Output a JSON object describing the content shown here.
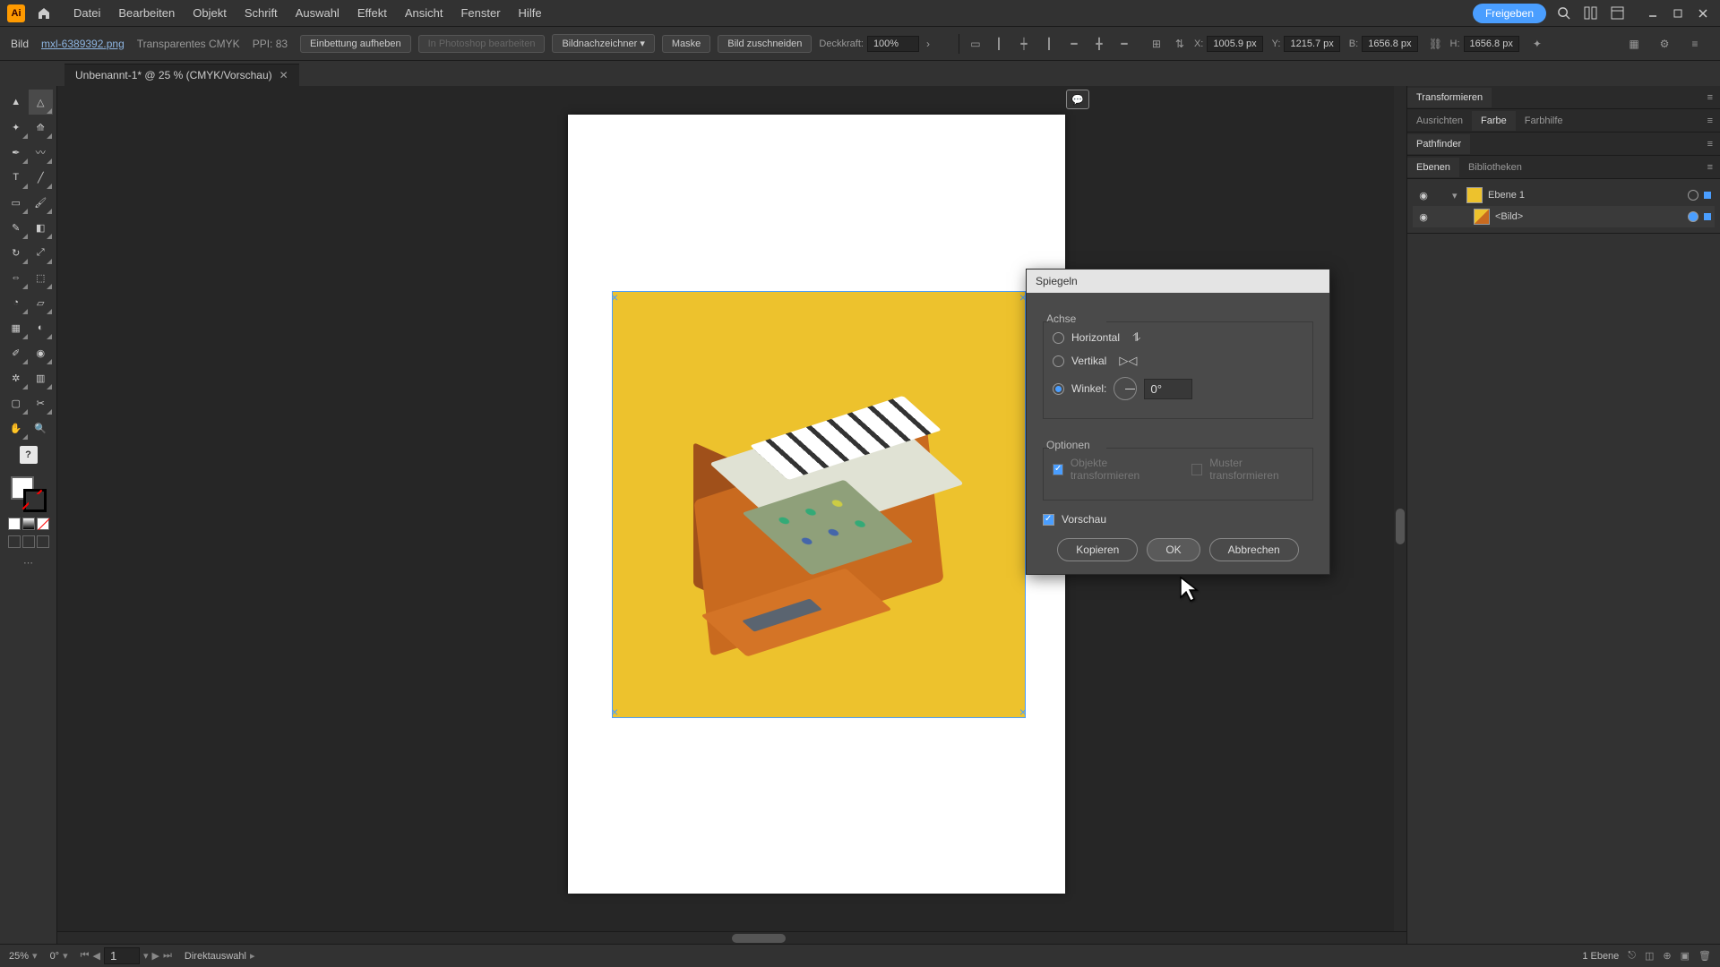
{
  "app": {
    "icon_text": "Ai",
    "share_label": "Freigeben"
  },
  "menu": [
    "Datei",
    "Bearbeiten",
    "Objekt",
    "Schrift",
    "Auswahl",
    "Effekt",
    "Ansicht",
    "Fenster",
    "Hilfe"
  ],
  "optionsbar": {
    "selection_type": "Bild",
    "filename": "mxl-6389392.png",
    "color_mode": "Transparentes CMYK",
    "ppi": "PPI: 83",
    "unembed": "Einbettung aufheben",
    "edit_ps": "In Photoshop bearbeiten",
    "tracer": "Bildnachzeichner",
    "mask": "Maske",
    "crop": "Bild zuschneiden",
    "opacity_label": "Deckkraft:",
    "opacity_value": "100%",
    "x_label": "X:",
    "x_value": "1005.9 px",
    "y_label": "Y:",
    "y_value": "1215.7 px",
    "w_label": "B:",
    "w_value": "1656.8 px",
    "h_label": "H:",
    "h_value": "1656.8 px"
  },
  "document": {
    "tab_title": "Unbenannt-1* @ 25 % (CMYK/Vorschau)"
  },
  "dialog": {
    "title": "Spiegeln",
    "axis_group": "Achse",
    "horizontal": "Horizontal",
    "vertical": "Vertikal",
    "angle_label": "Winkel:",
    "angle_value": "0°",
    "options_group": "Optionen",
    "transform_objects": "Objekte transformieren",
    "transform_patterns": "Muster transformieren",
    "preview": "Vorschau",
    "copy_btn": "Kopieren",
    "ok_btn": "OK",
    "cancel_btn": "Abbrechen"
  },
  "panels": {
    "transform": "Transformieren",
    "align": "Ausrichten",
    "color": "Farbe",
    "guides": "Farbhilfe",
    "pathfinder": "Pathfinder",
    "layers": "Ebenen",
    "libraries": "Bibliotheken",
    "layer1_name": "Ebene 1",
    "image_item": "<Bild>",
    "layer_count": "1 Ebene"
  },
  "status": {
    "zoom": "25%",
    "rotation": "0°",
    "artboard_num": "1",
    "tool": "Direktauswahl"
  },
  "help_icon": "?"
}
